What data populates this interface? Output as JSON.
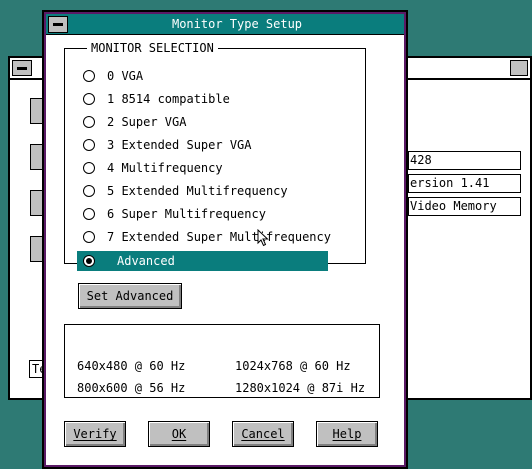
{
  "background_window": {
    "fields": [
      "428",
      "ersion 1.41",
      "Video Memory"
    ],
    "small_box_text": "Te"
  },
  "dialog": {
    "title": "Monitor Type Setup",
    "group_label": "MONITOR SELECTION",
    "options": [
      {
        "label": "0 VGA",
        "selected": false
      },
      {
        "label": "1 8514 compatible",
        "selected": false
      },
      {
        "label": "2 Super VGA",
        "selected": false
      },
      {
        "label": "3 Extended Super VGA",
        "selected": false
      },
      {
        "label": "4 Multifrequency",
        "selected": false
      },
      {
        "label": "5 Extended Multifrequency",
        "selected": false
      },
      {
        "label": "6 Super Multifrequency",
        "selected": false
      },
      {
        "label": "7 Extended Super Multifrequency",
        "selected": false
      },
      {
        "label": "Advanced",
        "selected": true
      }
    ],
    "set_advanced_label": "Set Advanced",
    "modes": {
      "row1_left": "640x480 @ 60 Hz",
      "row1_right": "1024x768  @ 60 Hz",
      "row2_left": "800x600 @ 56 Hz",
      "row2_right": "1280x1024 @ 87i Hz"
    },
    "buttons": {
      "verify": "Verify",
      "ok": "OK",
      "cancel": "Cancel",
      "help": "Help"
    }
  },
  "colors": {
    "desktop": "#2e7a74",
    "title_bar": "#0a7d7d",
    "selection": "#0a7d7d",
    "button_face": "#c0c0c0"
  }
}
